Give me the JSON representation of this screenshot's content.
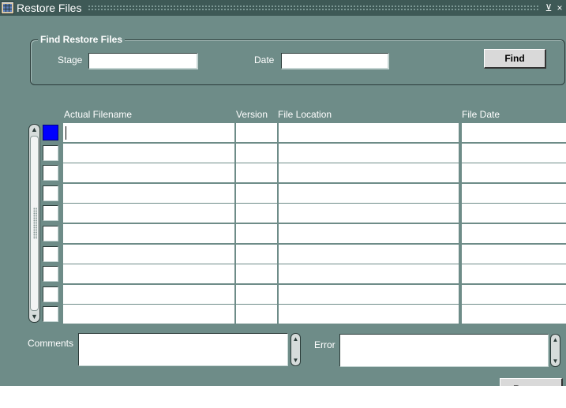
{
  "window": {
    "title": "Restore Files",
    "minimize_glyph": "⊻",
    "close_glyph": "×"
  },
  "find_group": {
    "legend": "Find Restore Files",
    "stage_label": "Stage",
    "stage_value": "",
    "date_label": "Date",
    "date_value": "",
    "find_button": "Find"
  },
  "table": {
    "columns": [
      "Actual Filename",
      "Version",
      "File Location",
      "File Date"
    ],
    "rows": [
      {
        "filename": "",
        "version": "",
        "location": "",
        "date": ""
      },
      {
        "filename": "",
        "version": "",
        "location": "",
        "date": ""
      },
      {
        "filename": "",
        "version": "",
        "location": "",
        "date": ""
      },
      {
        "filename": "",
        "version": "",
        "location": "",
        "date": ""
      },
      {
        "filename": "",
        "version": "",
        "location": "",
        "date": ""
      },
      {
        "filename": "",
        "version": "",
        "location": "",
        "date": ""
      },
      {
        "filename": "",
        "version": "",
        "location": "",
        "date": ""
      },
      {
        "filename": "",
        "version": "",
        "location": "",
        "date": ""
      },
      {
        "filename": "",
        "version": "",
        "location": "",
        "date": ""
      },
      {
        "filename": "",
        "version": "",
        "location": "",
        "date": ""
      }
    ],
    "selected_row": 0
  },
  "bottom": {
    "comments_label": "Comments",
    "comments_value": "",
    "error_label": "Error",
    "error_value": "",
    "restore_button": "Restore"
  },
  "colors": {
    "window_bg": "#6e8c88",
    "titlebar_bg": "#3e5956",
    "selection": "#0000ff"
  },
  "icons": {
    "title": "grid-form-icon",
    "minimize": "minimize-icon",
    "close": "close-icon",
    "scroll_up": "arrow-up-icon",
    "scroll_down": "arrow-down-icon"
  }
}
